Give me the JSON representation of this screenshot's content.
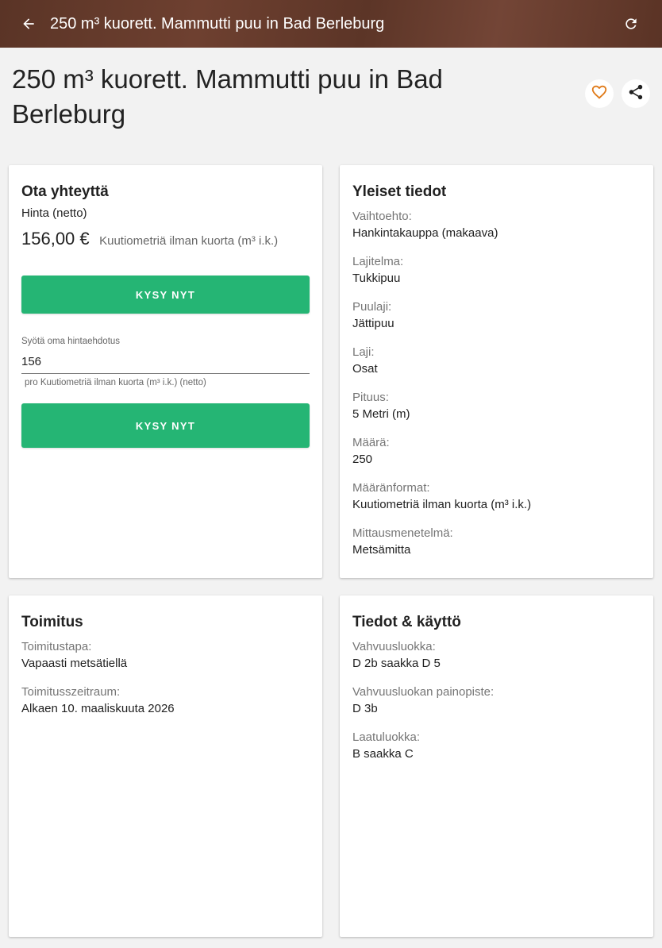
{
  "appbar": {
    "title": "250 m³ kuorett. Mammutti puu in Bad Berleburg",
    "back_icon": "arrow-left-icon",
    "refresh_icon": "refresh-icon",
    "color": "#5e3628"
  },
  "page": {
    "title": "250 m³ kuorett. Mammutti puu in Bad Berleburg",
    "favorite_icon": "heart-outline-icon",
    "share_icon": "share-icon",
    "favorite_color": "#e07b1a"
  },
  "contact": {
    "heading": "Ota yhteyttä",
    "price_label": "Hinta (netto)",
    "price_value": "156,00 €",
    "price_unit": "Kuutiometriä ilman kuorta (m³ i.k.)",
    "ask_button": "KYSY NYT",
    "offer_label": "Syötä oma hintaehdotus",
    "offer_value": "156",
    "offer_hint": "pro Kuutiometriä ilman kuorta (m³ i.k.) (netto)",
    "ask_button_2": "KYSY NYT",
    "button_color": "#25b574"
  },
  "general": {
    "heading": "Yleiset tiedot",
    "fields": [
      {
        "label": "Vaihtoehto:",
        "value": "Hankintakauppa (makaava)"
      },
      {
        "label": "Lajitelma:",
        "value": "Tukkipuu"
      },
      {
        "label": "Puulaji:",
        "value": "Jättipuu"
      },
      {
        "label": "Laji:",
        "value": "Osat"
      },
      {
        "label": "Pituus:",
        "value": "5 Metri (m)"
      },
      {
        "label": "Määrä:",
        "value": "250"
      },
      {
        "label": "Määränformat:",
        "value": "Kuutiometriä ilman kuorta (m³ i.k.)"
      },
      {
        "label": "Mittausmenetelmä:",
        "value": "Metsämitta"
      }
    ]
  },
  "delivery": {
    "heading": "Toimitus",
    "fields": [
      {
        "label": "Toimitustapa:",
        "value": "Vapaasti metsätiellä"
      },
      {
        "label": "Toimitusszeitraum:",
        "value": "Alkaen 10. maaliskuuta 2026"
      }
    ]
  },
  "info": {
    "heading": "Tiedot & käyttö",
    "fields": [
      {
        "label": "Vahvuusluokka:",
        "value": "D 2b saakka D 5"
      },
      {
        "label": "Vahvuusluokan painopiste:",
        "value": "D 3b"
      },
      {
        "label": "Laatuluokka:",
        "value": "B saakka C"
      }
    ]
  }
}
